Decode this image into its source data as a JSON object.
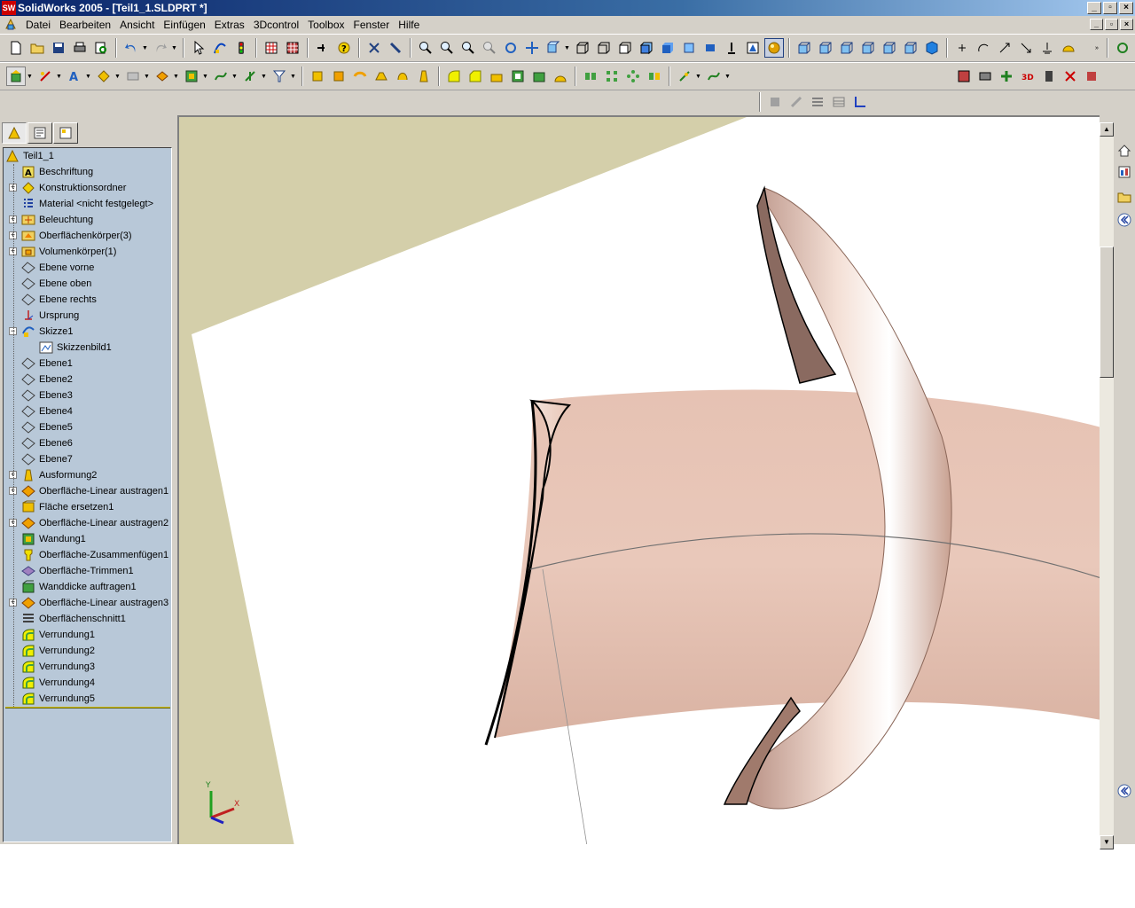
{
  "window": {
    "title": "SolidWorks 2005 - [Teil1_1.SLDPRT *]",
    "app_icon": "SW",
    "minimize": "_",
    "restore": "▫",
    "close": "×"
  },
  "menu": {
    "items": [
      "Datei",
      "Bearbeiten",
      "Ansicht",
      "Einfügen",
      "Extras",
      "3Dcontrol",
      "Toolbox",
      "Fenster",
      "Hilfe"
    ]
  },
  "feature_tree": {
    "items": [
      {
        "label": "Teil1_1",
        "icon": "part-icon"
      },
      {
        "label": "Beschriftung",
        "icon": "annotation-icon"
      },
      {
        "label": "Konstruktionsordner",
        "icon": "folder-icon",
        "expandable": true
      },
      {
        "label": "Material <nicht festgelegt>",
        "icon": "material-icon"
      },
      {
        "label": "Beleuchtung",
        "icon": "lighting-icon",
        "expandable": true
      },
      {
        "label": "Oberflächenkörper(3)",
        "icon": "surface-bodies-icon",
        "expandable": true
      },
      {
        "label": "Volumenkörper(1)",
        "icon": "solid-bodies-icon",
        "expandable": true
      },
      {
        "label": "Ebene vorne",
        "icon": "plane-icon"
      },
      {
        "label": "Ebene oben",
        "icon": "plane-icon"
      },
      {
        "label": "Ebene rechts",
        "icon": "plane-icon"
      },
      {
        "label": "Ursprung",
        "icon": "origin-icon"
      },
      {
        "label": "Skizze1",
        "icon": "sketch-icon",
        "expanded": true
      },
      {
        "label": "Skizzenbild1",
        "icon": "sketch-picture-icon",
        "child": true
      },
      {
        "label": "Ebene1",
        "icon": "plane-icon"
      },
      {
        "label": "Ebene2",
        "icon": "plane-icon"
      },
      {
        "label": "Ebene3",
        "icon": "plane-icon"
      },
      {
        "label": "Ebene4",
        "icon": "plane-icon"
      },
      {
        "label": "Ebene5",
        "icon": "plane-icon"
      },
      {
        "label": "Ebene6",
        "icon": "plane-icon"
      },
      {
        "label": "Ebene7",
        "icon": "plane-icon"
      },
      {
        "label": "Ausformung2",
        "icon": "draft-icon",
        "expandable": true
      },
      {
        "label": "Oberfläche-Linear austragen1",
        "icon": "surface-extrude-icon",
        "expandable": true
      },
      {
        "label": "Fläche ersetzen1",
        "icon": "replace-face-icon"
      },
      {
        "label": "Oberfläche-Linear austragen2",
        "icon": "surface-extrude-icon",
        "expandable": true
      },
      {
        "label": "Wandung1",
        "icon": "shell-icon"
      },
      {
        "label": "Oberfläche-Zusammenfügen1",
        "icon": "knit-icon"
      },
      {
        "label": "Oberfläche-Trimmen1",
        "icon": "trim-icon"
      },
      {
        "label": "Wanddicke auftragen1",
        "icon": "thicken-icon"
      },
      {
        "label": "Oberfläche-Linear austragen3",
        "icon": "surface-extrude-icon",
        "expandable": true
      },
      {
        "label": "Oberflächenschnitt1",
        "icon": "surface-cut-icon"
      },
      {
        "label": "Verrundung1",
        "icon": "fillet-icon"
      },
      {
        "label": "Verrundung2",
        "icon": "fillet-icon"
      },
      {
        "label": "Verrundung3",
        "icon": "fillet-icon"
      },
      {
        "label": "Verrundung4",
        "icon": "fillet-icon"
      },
      {
        "label": "Verrundung5",
        "icon": "fillet-icon"
      }
    ]
  },
  "triad": {
    "x_label": "X",
    "y_label": "Y"
  },
  "colors": {
    "model": "#e8c4b4",
    "background_plane": "#d4cfaa",
    "tree_bg": "#b8c8d8",
    "title_gradient_start": "#0a246a"
  }
}
